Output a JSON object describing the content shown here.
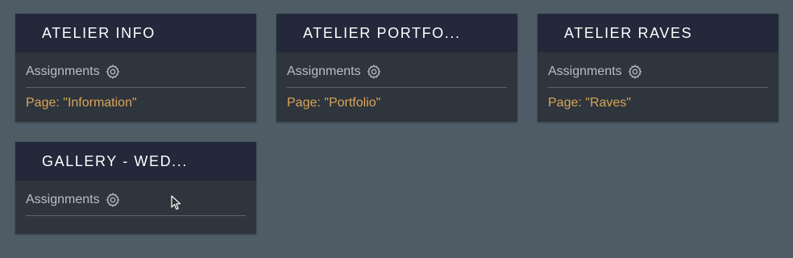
{
  "cards": [
    {
      "title": "ATELIER INFO",
      "assignments_label": "Assignments",
      "page_text": "Page: \"Information\""
    },
    {
      "title": "ATELIER PORTFO...",
      "assignments_label": "Assignments",
      "page_text": "Page: \"Portfolio\""
    },
    {
      "title": "ATELIER RAVES",
      "assignments_label": "Assignments",
      "page_text": "Page: \"Raves\""
    },
    {
      "title": "GALLERY - WED...",
      "assignments_label": "Assignments",
      "page_text": ""
    }
  ],
  "icons": {
    "settings": "gear-icon",
    "cursor": "mouse-pointer-icon"
  },
  "colors": {
    "background": "#4f5c66",
    "card_header": "#23283a",
    "card_body": "#2f353c",
    "page_accent": "#d9a55a"
  }
}
